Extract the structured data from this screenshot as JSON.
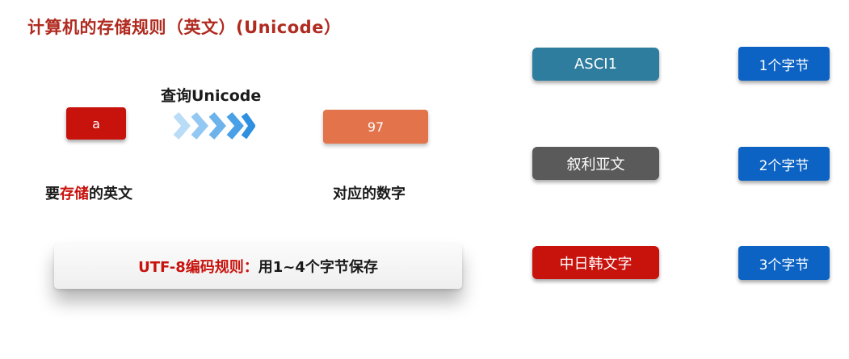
{
  "title": "计算机的存储规则（英文）(Unicode）",
  "flow": {
    "input_char": "a",
    "lookup_label": "查询Unicode",
    "output_number": "97",
    "caption_input_prefix": "要",
    "caption_input_highlight": "存储",
    "caption_input_suffix": "的英文",
    "caption_output": "对应的数字"
  },
  "utf8": {
    "label": "UTF-8编码规则：",
    "text": "用1~4个字节保存"
  },
  "encodings": [
    {
      "name": "ASCI1",
      "bytes": "1个字节"
    },
    {
      "name": "叙利亚文",
      "bytes": "2个字节"
    },
    {
      "name": "中日韩文字",
      "bytes": "3个字节"
    }
  ],
  "colors": {
    "title": "#b02a1f",
    "highlight": "#c8120c",
    "number_box": "#e2734a",
    "ascii_box": "#2e7d9e",
    "syriac_box": "#5a5a5a",
    "cjk_box": "#c8120c",
    "bytes_box": "#0c63c4",
    "arrow_light": "#a9d4f5",
    "arrow_dark": "#2f8fe0"
  }
}
